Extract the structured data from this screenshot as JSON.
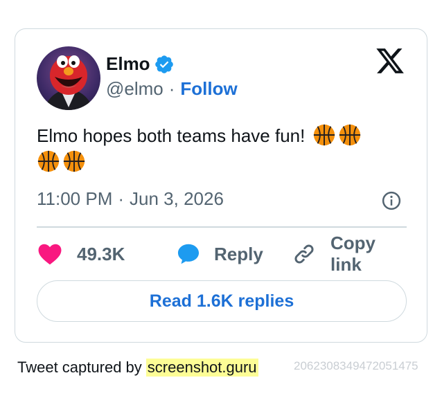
{
  "author": {
    "name": "Elmo",
    "handle": "@elmo",
    "follow_label": "Follow",
    "separator": "·"
  },
  "tweet": {
    "text": "Elmo hopes both teams have fun!",
    "emoji_count": 4,
    "emoji_icon": "basketball-icon",
    "time": "11:00 PM",
    "date": "Jun 3, 2026",
    "separator": "·"
  },
  "actions": {
    "likes": "49.3K",
    "reply_label": "Reply",
    "copy_link_label": "Copy link"
  },
  "read_replies_label": "Read 1.6K replies",
  "footer": {
    "prefix": "Tweet captured by",
    "brand": "screenshot.guru",
    "tweet_id": "2062308349472051475"
  },
  "colors": {
    "link_blue": "#1d70d6",
    "like_pink": "#f91880",
    "reply_blue": "#1d9bf0",
    "muted": "#536471",
    "border": "#cfd9de",
    "highlight": "#fdfd96"
  }
}
